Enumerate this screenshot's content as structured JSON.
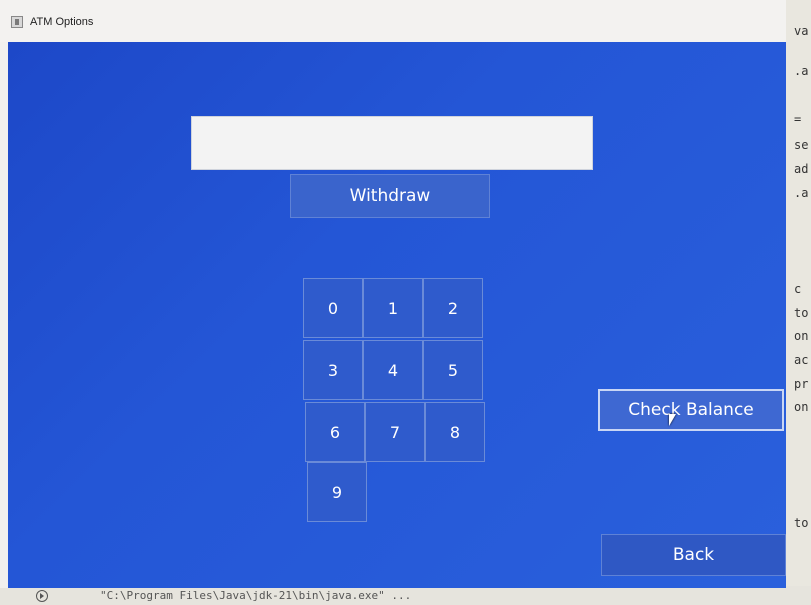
{
  "window": {
    "title": "ATM Options"
  },
  "amount_input": {
    "value": "",
    "placeholder": ""
  },
  "buttons": {
    "withdraw": "Withdraw",
    "check_balance": "Check Balance",
    "back": "Back"
  },
  "keypad": {
    "keys": [
      "0",
      "1",
      "2",
      "3",
      "4",
      "5",
      "6",
      "7",
      "8",
      "9"
    ]
  },
  "background_window": {
    "fragments": [
      "va",
      ".a",
      "=",
      "se",
      "ad",
      ".a",
      "c",
      "to",
      "on",
      "ac",
      "pr",
      "on",
      "to"
    ]
  },
  "console": {
    "text": "\"C:\\Program Files\\Java\\jdk-21\\bin\\java.exe\" ..."
  },
  "colors": {
    "panel_blue": "#2456d6",
    "button_blue": "#3560c9",
    "text_white": "#ffffff"
  }
}
